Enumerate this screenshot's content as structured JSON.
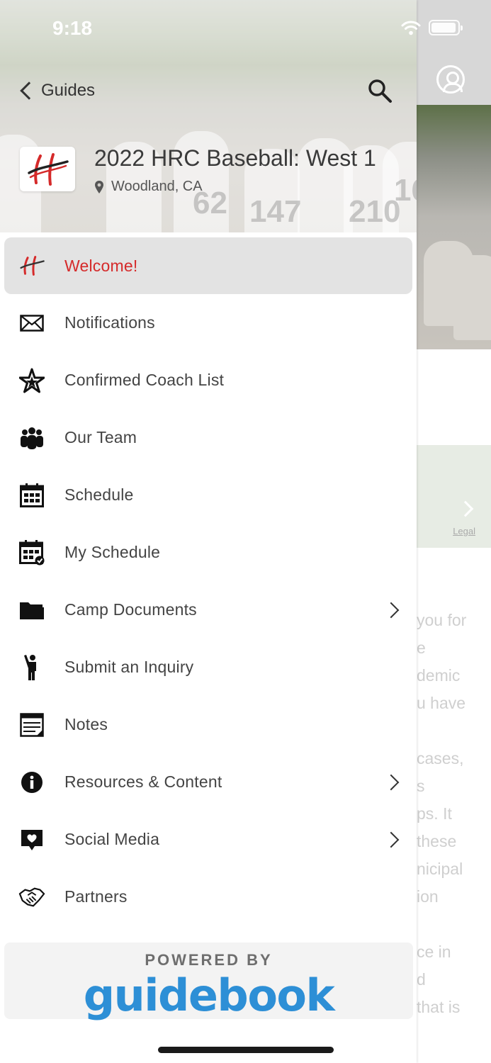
{
  "status_bar": {
    "time": "9:18"
  },
  "header": {
    "back_label": "Guides",
    "guide_title": "2022 HRC Baseball: West 1",
    "location": "Woodland, CA"
  },
  "menu": {
    "items": [
      {
        "label": "Welcome!",
        "icon": "hrc-logo-icon",
        "active": true,
        "has_arrow": false
      },
      {
        "label": "Notifications",
        "icon": "envelope-icon",
        "has_arrow": false
      },
      {
        "label": "Confirmed Coach List",
        "icon": "star-icon",
        "has_arrow": false
      },
      {
        "label": "Our Team",
        "icon": "people-icon",
        "has_arrow": false
      },
      {
        "label": "Schedule",
        "icon": "calendar-icon",
        "has_arrow": false
      },
      {
        "label": "My Schedule",
        "icon": "calendar-check-icon",
        "has_arrow": false
      },
      {
        "label": "Camp Documents",
        "icon": "folder-icon",
        "has_arrow": true
      },
      {
        "label": "Submit an Inquiry",
        "icon": "person-raising-hand-icon",
        "has_arrow": false
      },
      {
        "label": "Notes",
        "icon": "notepad-icon",
        "has_arrow": false
      },
      {
        "label": "Resources & Content",
        "icon": "info-icon",
        "has_arrow": true
      },
      {
        "label": "Social Media",
        "icon": "heart-chat-icon",
        "has_arrow": true
      },
      {
        "label": "Partners",
        "icon": "handshake-icon",
        "has_arrow": false
      }
    ]
  },
  "footer": {
    "powered_by": "POWERED BY",
    "brand": "guidebook"
  },
  "background_page": {
    "legal": "Legal",
    "text_fragments": [
      "you for",
      "e",
      "demic",
      "u have",
      "",
      "cases,",
      "s",
      "ps. It",
      "these",
      "nicipal",
      "ion",
      "",
      "ce in",
      "d",
      "that is"
    ]
  },
  "colors": {
    "accent": "#d52a2a",
    "brand_blue": "#2d8fd6",
    "active_bg": "#e3e3e3"
  }
}
